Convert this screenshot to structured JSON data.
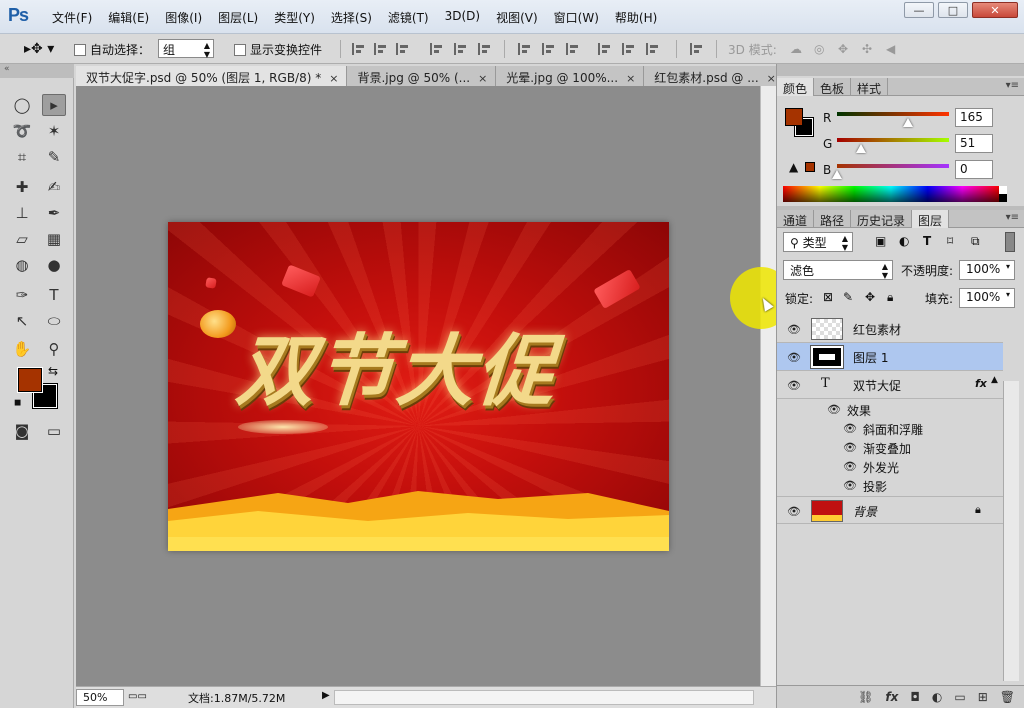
{
  "app": {
    "logo": "Ps"
  },
  "menu": [
    "文件(F)",
    "编辑(E)",
    "图像(I)",
    "图层(L)",
    "类型(Y)",
    "选择(S)",
    "滤镜(T)",
    "3D(D)",
    "视图(V)",
    "窗口(W)",
    "帮助(H)"
  ],
  "window_controls": {
    "minimize": "—",
    "maximize": "□",
    "close": "✕"
  },
  "options": {
    "auto_select_label": "自动选择：",
    "auto_select_value": "组",
    "show_transform_label": "显示变换控件",
    "mode_3d_label": "3D 模式:"
  },
  "tabs": [
    {
      "label": "双节大促字.psd @ 50% (图层 1, RGB/8) *",
      "close": "×"
    },
    {
      "label": "背景.jpg @ 50% (...",
      "close": "×"
    },
    {
      "label": "光晕.jpg @ 100%...",
      "close": "×"
    },
    {
      "label": "红包素材.psd @ ...",
      "close": "×"
    }
  ],
  "artwork": {
    "headline": "双节大促"
  },
  "status": {
    "zoom": "50%",
    "doc_info": "文档:1.87M/5.72M",
    "arrow": "▶"
  },
  "colors": {
    "foreground": "#a53300",
    "background": "#000000",
    "canvas_bg": "#8c8c8c",
    "selected_layer": "#aec7ef"
  },
  "color_panel": {
    "tabs": [
      "颜色",
      "色板",
      "样式"
    ],
    "channels": [
      {
        "label": "R",
        "value": "165"
      },
      {
        "label": "G",
        "value": "51"
      },
      {
        "label": "B",
        "value": "0"
      }
    ]
  },
  "layers_panel": {
    "tabs": [
      "通道",
      "路径",
      "历史记录",
      "图层"
    ],
    "filter_kind": "类型",
    "blend_mode": "滤色",
    "opacity_label": "不透明度:",
    "opacity_value": "100%",
    "lock_label": "锁定:",
    "fill_label": "填充:",
    "fill_value": "100%",
    "layers": [
      {
        "name": "红包素材",
        "type": "image"
      },
      {
        "name": "图层 1",
        "type": "image",
        "selected": true
      },
      {
        "name": "双节大促",
        "type": "text",
        "fx": "fx"
      },
      {
        "name": "背景",
        "type": "background"
      }
    ],
    "effects_label": "效果",
    "effects": [
      "斜面和浮雕",
      "渐变叠加",
      "外发光",
      "投影"
    ],
    "text_layer_icon": "T"
  },
  "tools": {
    "quick_swap": "⇆",
    "default_colors": "◼"
  }
}
